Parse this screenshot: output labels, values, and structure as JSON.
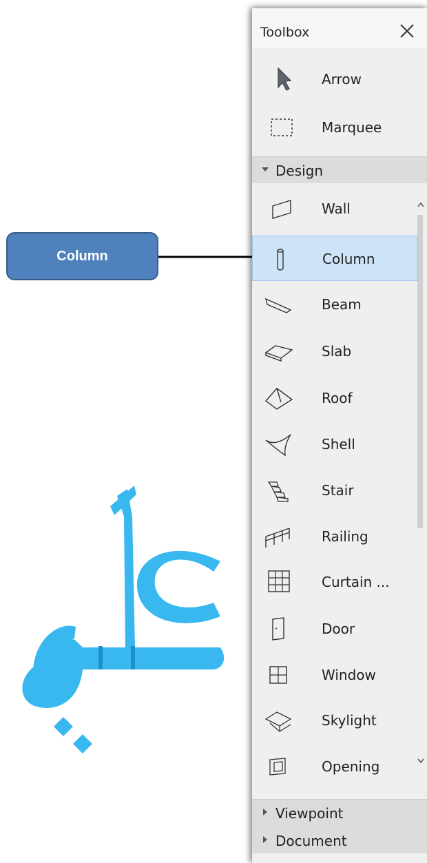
{
  "toolbox": {
    "title": "Toolbox",
    "close_icon": "close-icon",
    "top_tools": [
      {
        "label": "Arrow",
        "icon": "arrow-pointer-icon"
      },
      {
        "label": "Marquee",
        "icon": "marquee-icon"
      }
    ],
    "design_section": {
      "label": "Design",
      "expanded": true,
      "tools": [
        {
          "label": "Wall",
          "icon": "wall-icon"
        },
        {
          "label": "Column",
          "icon": "column-icon",
          "selected": true
        },
        {
          "label": "Beam",
          "icon": "beam-icon"
        },
        {
          "label": "Slab",
          "icon": "slab-icon"
        },
        {
          "label": "Roof",
          "icon": "roof-icon"
        },
        {
          "label": "Shell",
          "icon": "shell-icon"
        },
        {
          "label": "Stair",
          "icon": "stair-icon"
        },
        {
          "label": "Railing",
          "icon": "railing-icon"
        },
        {
          "label": "Curtain ...",
          "icon": "curtain-wall-icon"
        },
        {
          "label": "Door",
          "icon": "door-icon"
        },
        {
          "label": "Window",
          "icon": "window-icon"
        },
        {
          "label": "Skylight",
          "icon": "skylight-icon"
        },
        {
          "label": "Opening",
          "icon": "opening-icon"
        }
      ]
    },
    "collapsed_sections": [
      {
        "label": "Viewpoint"
      },
      {
        "label": "Document"
      }
    ]
  },
  "callout": {
    "label": "Column",
    "color": "#4f81bd"
  },
  "watermark": {
    "text": "علي",
    "color": "#39b8f0"
  },
  "selection_color": "#cde3f7"
}
